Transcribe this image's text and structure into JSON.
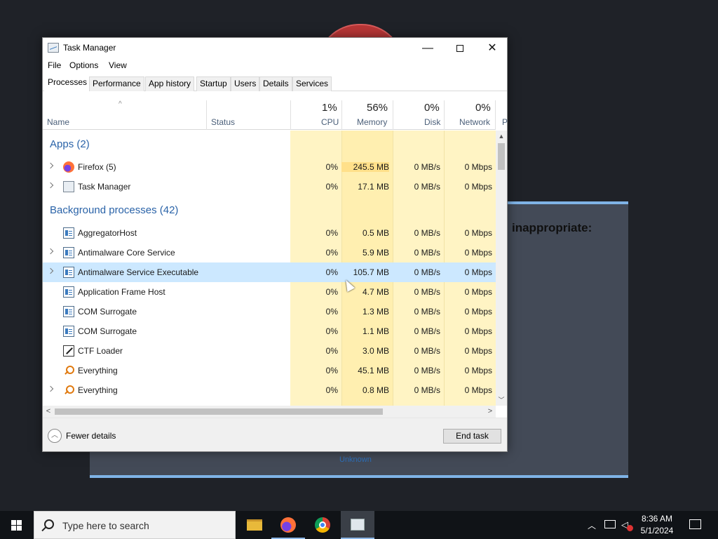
{
  "background_dialog": {
    "heading": "inappropriate:",
    "link": "Unknown"
  },
  "window": {
    "title": "Task Manager",
    "minimize_glyph": "—",
    "close_glyph": "✕"
  },
  "menu": [
    "File",
    "Options",
    "View"
  ],
  "tabs": [
    "Processes",
    "Performance",
    "App history",
    "Startup",
    "Users",
    "Details",
    "Services"
  ],
  "header": {
    "sort_glyph": "^",
    "name": "Name",
    "status": "Status",
    "cpu_pct": "1%",
    "cpu": "CPU",
    "memory_pct": "56%",
    "memory": "Memory",
    "disk_pct": "0%",
    "disk": "Disk",
    "network_pct": "0%",
    "network": "Network",
    "power_truncated": "P"
  },
  "groups": {
    "apps": "Apps (2)",
    "background": "Background processes (42)"
  },
  "processes": [
    {
      "name": "Firefox (5)",
      "cpu": "0%",
      "memory": "245.5 MB",
      "disk": "0 MB/s",
      "network": "0 Mbps"
    },
    {
      "name": "Task Manager",
      "cpu": "0%",
      "memory": "17.1 MB",
      "disk": "0 MB/s",
      "network": "0 Mbps"
    },
    {
      "name": "AggregatorHost",
      "cpu": "0%",
      "memory": "0.5 MB",
      "disk": "0 MB/s",
      "network": "0 Mbps"
    },
    {
      "name": "Antimalware Core Service",
      "cpu": "0%",
      "memory": "5.9 MB",
      "disk": "0 MB/s",
      "network": "0 Mbps"
    },
    {
      "name": "Antimalware Service Executable",
      "cpu": "0%",
      "memory": "105.7 MB",
      "disk": "0 MB/s",
      "network": "0 Mbps"
    },
    {
      "name": "Application Frame Host",
      "cpu": "0%",
      "memory": "4.7 MB",
      "disk": "0 MB/s",
      "network": "0 Mbps"
    },
    {
      "name": "COM Surrogate",
      "cpu": "0%",
      "memory": "1.3 MB",
      "disk": "0 MB/s",
      "network": "0 Mbps"
    },
    {
      "name": "COM Surrogate",
      "cpu": "0%",
      "memory": "1.1 MB",
      "disk": "0 MB/s",
      "network": "0 Mbps"
    },
    {
      "name": "CTF Loader",
      "cpu": "0%",
      "memory": "3.0 MB",
      "disk": "0 MB/s",
      "network": "0 Mbps"
    },
    {
      "name": "Everything",
      "cpu": "0%",
      "memory": "45.1 MB",
      "disk": "0 MB/s",
      "network": "0 Mbps"
    },
    {
      "name": "Everything",
      "cpu": "0%",
      "memory": "0.8 MB",
      "disk": "0 MB/s",
      "network": "0 Mbps"
    }
  ],
  "scroll_glyphs": {
    "up": "▲",
    "down": "﹀",
    "left": "<",
    "right": ">"
  },
  "footer": {
    "fewer_glyph": "︿",
    "fewer_details": "Fewer details",
    "end_task": "End task"
  },
  "taskbar": {
    "search_placeholder": "Type here to search",
    "chevron_glyph": "︿",
    "volume_glyph": "◁",
    "time": "8:36 AM",
    "date": "5/1/2024"
  },
  "colors": {
    "group_text": "#2a63a8",
    "heat_light": "#fff4c4",
    "heat_mid": "#ffefb0",
    "heat_memory_high": "#ffe08a",
    "selected_row": "#cce8ff",
    "taskbar": "#101317"
  }
}
